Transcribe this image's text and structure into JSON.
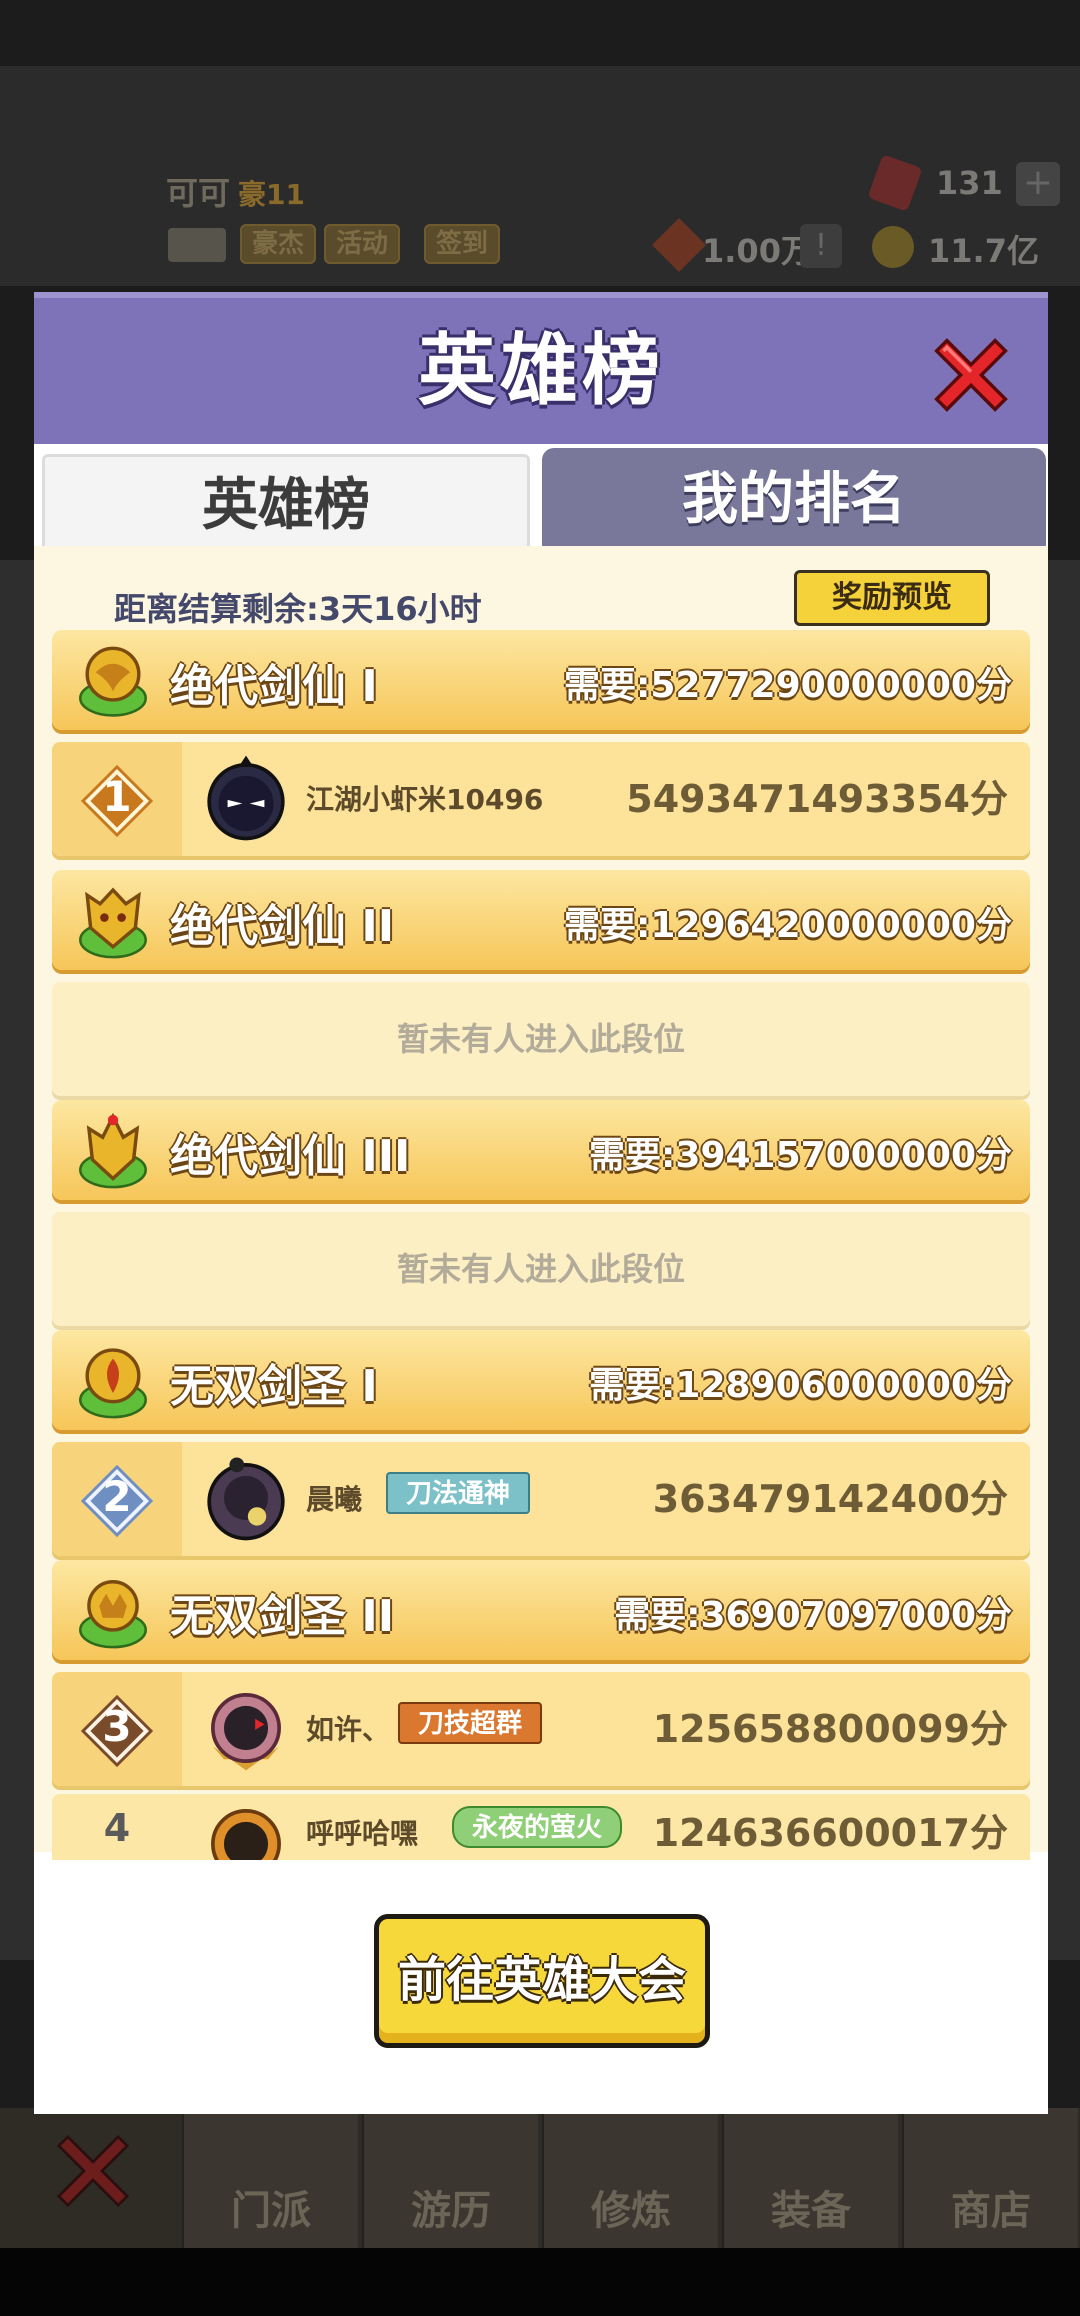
{
  "background": {
    "player_name": "可可",
    "player_level": "豪11",
    "buttons": [
      "豪杰",
      "活动",
      "签到"
    ],
    "gems": "131",
    "silver": "1.00万",
    "gold": "11.7亿",
    "plus": "+",
    "bang": "!"
  },
  "bottom_nav": {
    "items": [
      "门派",
      "游历",
      "修炼",
      "装备",
      "商店"
    ]
  },
  "modal": {
    "title": "英雄榜",
    "tabs": [
      "英雄榜",
      "我的排名"
    ],
    "countdown": "距离结算剩余:3天16小时",
    "reward_button": "奖励预览",
    "tiers": [
      {
        "name": "绝代剑仙 I",
        "requirement": "需要:5277290000000分"
      },
      {
        "name": "绝代剑仙 II",
        "requirement": "需要:1296420000000分"
      },
      {
        "name": "绝代剑仙 III",
        "requirement": "需要:394157000000分"
      },
      {
        "name": "无双剑圣 I",
        "requirement": "需要:128906000000分"
      },
      {
        "name": "无双剑圣 II",
        "requirement": "需要:36907097000分"
      }
    ],
    "empty_text": "暂未有人进入此段位",
    "players": [
      {
        "rank": "1",
        "name": "江湖小虾米10496",
        "title": "",
        "score": "5493471493354分"
      },
      {
        "rank": "2",
        "name": "晨曦",
        "title": "刀法通神",
        "score": "363479142400分"
      },
      {
        "rank": "3",
        "name": "如许、",
        "title": "刀技超群",
        "score": "125658800099分"
      },
      {
        "rank": "4",
        "name": "呼呼哈嘿",
        "title": "永夜的萤火",
        "score": "124636600017分"
      }
    ],
    "go_button": "前往英雄大会"
  },
  "colors": {
    "header_purple": "#7e73b8",
    "tier_gold": "#f6c659",
    "rank1": "#c8791e",
    "rank2": "#6f8fc2",
    "rank3": "#7a4b2a"
  }
}
